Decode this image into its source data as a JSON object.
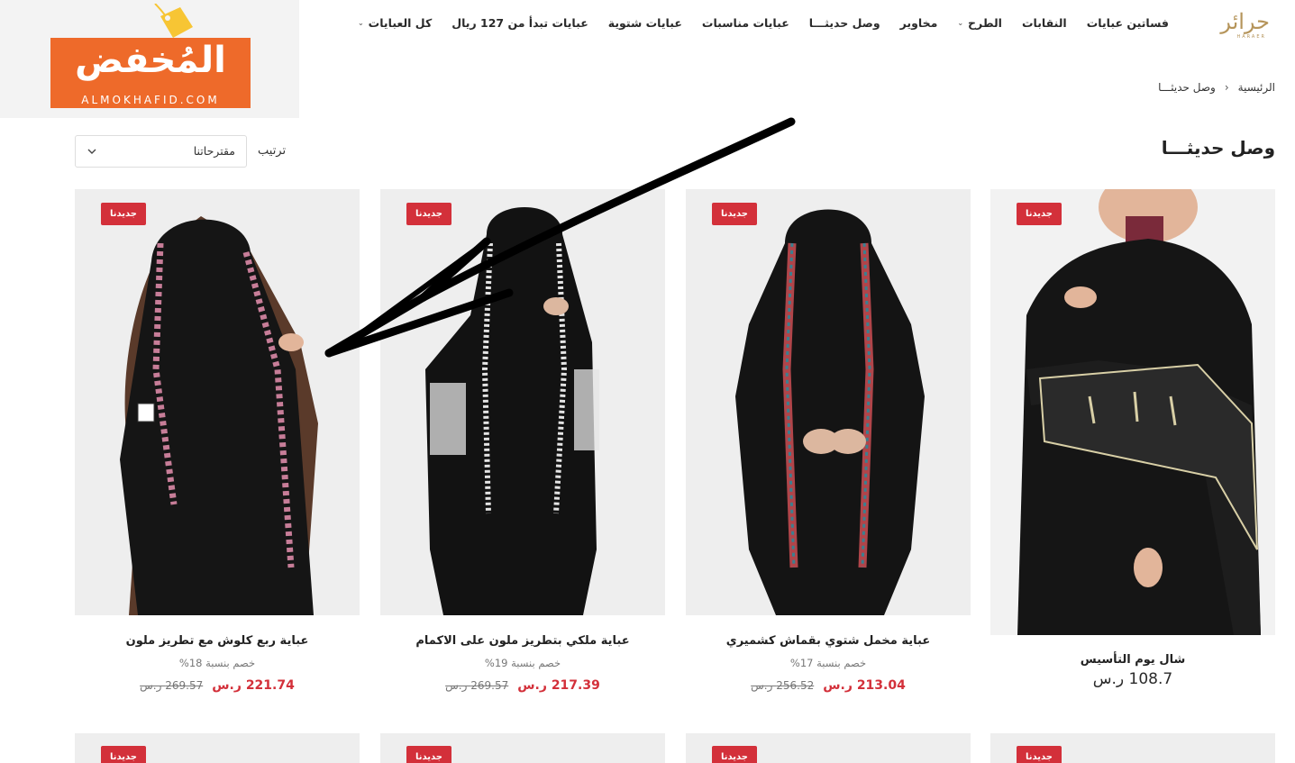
{
  "brand": {
    "logo_text": "حرائر",
    "logo_sub": "HARAER"
  },
  "nav": {
    "items": [
      {
        "label": "كل العبايات",
        "has_dropdown": true
      },
      {
        "label": "عبايات تبدأ من 127 ريال",
        "has_dropdown": false
      },
      {
        "label": "عبايات شتوية",
        "has_dropdown": false
      },
      {
        "label": "عبايات مناسبات",
        "has_dropdown": false
      },
      {
        "label": "وصل حديثـــا",
        "has_dropdown": false
      },
      {
        "label": "مخاوير",
        "has_dropdown": false
      },
      {
        "label": "الطرح",
        "has_dropdown": true
      },
      {
        "label": "النقابات",
        "has_dropdown": false
      },
      {
        "label": "فساتين عبايات",
        "has_dropdown": false
      }
    ]
  },
  "watermark": {
    "title": "المُخفض",
    "domain": "ALMOKHAFID.COM"
  },
  "breadcrumb": {
    "home": "الرئيسية",
    "separator": "›",
    "current": "وصل حديثـــا"
  },
  "page_title": "وصل حديثـــا",
  "sort": {
    "label": "ترتيب",
    "value": "مقترحاتنا"
  },
  "badge_label": "جديدنا",
  "products": [
    {
      "name": "شال يوم التأسيس",
      "price": "108.7 ر.س",
      "badge": "جديدنا"
    },
    {
      "name": "عباية مخمل شتوي بقماش كشميري",
      "discount": "خصم بنسبة 17%",
      "price_new": "213.04 ر.س",
      "price_old": "256.52 ر.س",
      "badge": "جديدنا"
    },
    {
      "name": "عباية ملكي بتطريز ملون على الاكمام",
      "discount": "خصم بنسبة 19%",
      "price_new": "217.39 ر.س",
      "price_old": "269.57 ر.س",
      "badge": "جديدنا"
    },
    {
      "name": "عباية ربع كلوش مع تطريز ملون",
      "discount": "خصم بنسبة 18%",
      "price_new": "221.74 ر.س",
      "price_old": "269.57 ر.س",
      "badge": "جديدنا"
    }
  ],
  "colors": {
    "accent_red": "#d3303a",
    "brand_gold": "#b5945a",
    "watermark_orange": "#ee6a2a"
  }
}
